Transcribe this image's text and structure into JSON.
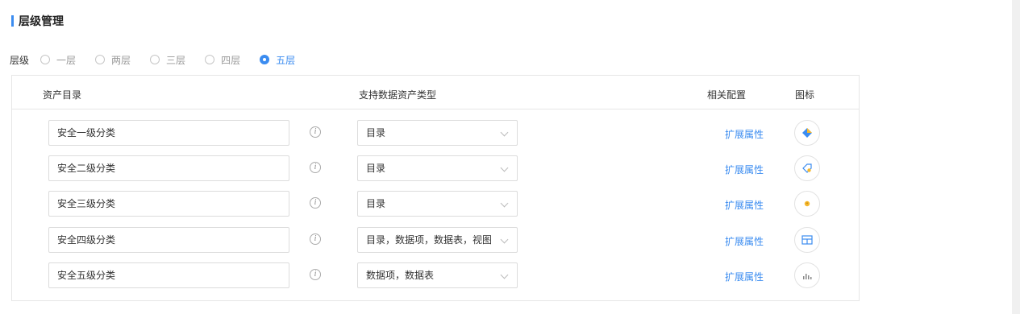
{
  "section": {
    "title": "层级管理"
  },
  "levels": {
    "label": "层级",
    "options": [
      {
        "label": "一层",
        "checked": false
      },
      {
        "label": "两层",
        "checked": false
      },
      {
        "label": "三层",
        "checked": false
      },
      {
        "label": "四层",
        "checked": false
      },
      {
        "label": "五层",
        "checked": true
      }
    ]
  },
  "table": {
    "headers": {
      "catalog": "资产目录",
      "types": "支持数据资产类型",
      "config": "相关配置",
      "icon": "图标"
    },
    "rows": [
      {
        "name": "安全一级分类",
        "info": "i",
        "types": "目录",
        "config_link": "扩展属性",
        "icon": "diamond-icon"
      },
      {
        "name": "安全二级分类",
        "info": "i",
        "types": "目录",
        "config_link": "扩展属性",
        "icon": "tag-icon"
      },
      {
        "name": "安全三级分类",
        "info": "i",
        "types": "目录",
        "config_link": "扩展属性",
        "icon": "dot-icon"
      },
      {
        "name": "安全四级分类",
        "info": "i",
        "types": "目录，数据项，数据表，视图",
        "config_link": "扩展属性",
        "icon": "table-icon"
      },
      {
        "name": "安全五级分类",
        "info": "i",
        "types": "数据项，数据表",
        "config_link": "扩展属性",
        "icon": "bar-chart-icon"
      }
    ]
  },
  "colors": {
    "accent": "#3b8cf0",
    "border": "#e6e6e6",
    "icon_yellow": "#f5b82e"
  }
}
